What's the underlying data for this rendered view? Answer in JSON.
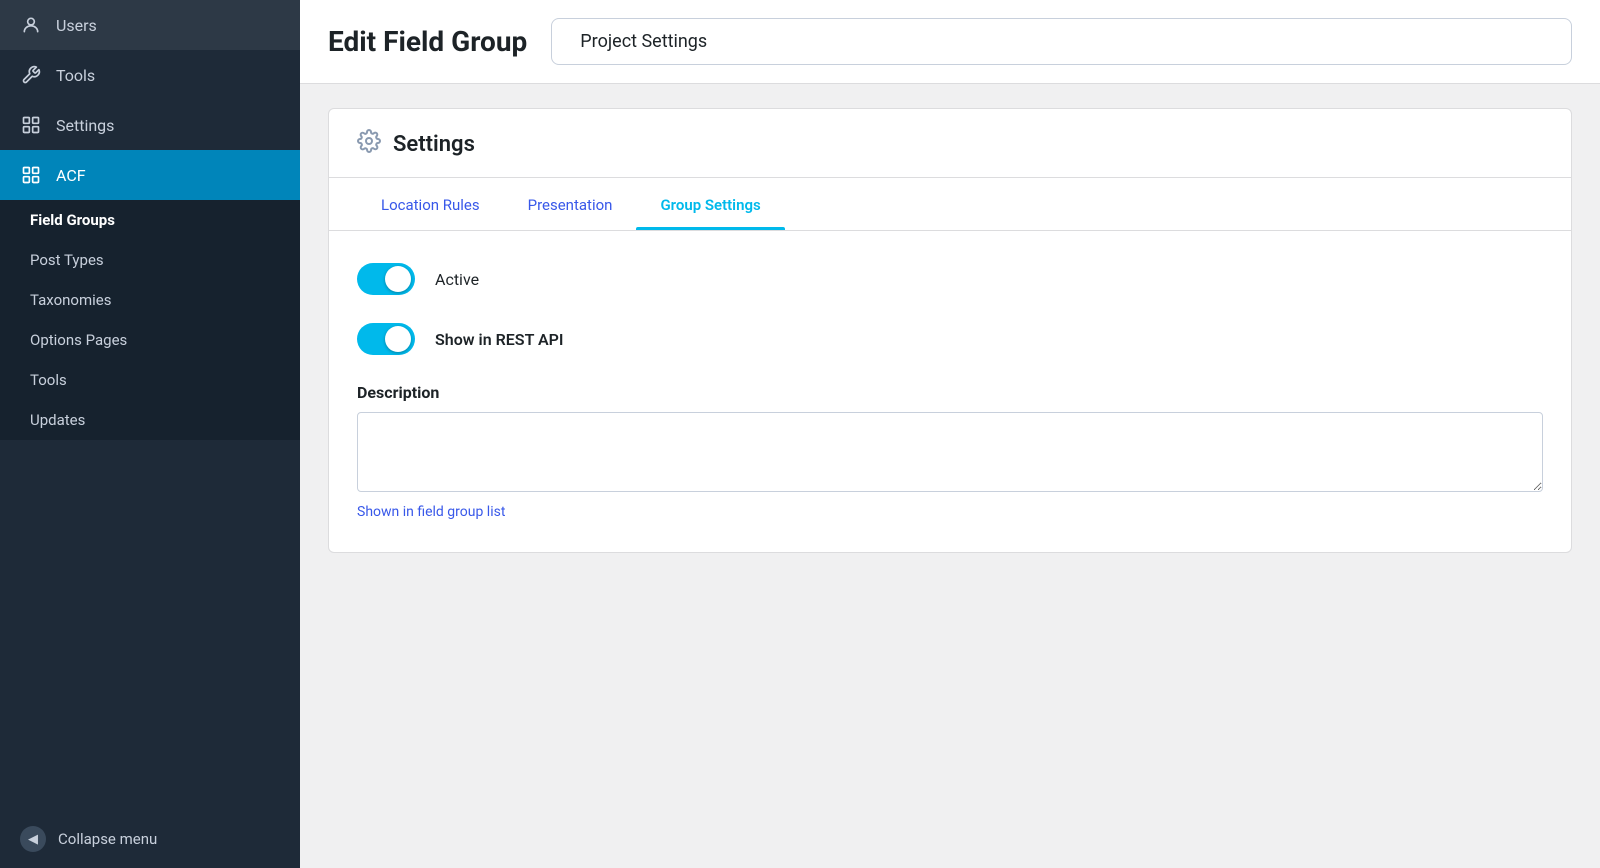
{
  "sidebar": {
    "items": [
      {
        "id": "users",
        "label": "Users",
        "icon": "👤"
      },
      {
        "id": "tools",
        "label": "Tools",
        "icon": "🔧"
      },
      {
        "id": "settings",
        "label": "Settings",
        "icon": "⊞"
      },
      {
        "id": "acf",
        "label": "ACF",
        "icon": "⊞",
        "active": true
      }
    ],
    "section_items": [
      {
        "id": "field-groups",
        "label": "Field Groups",
        "active": true
      },
      {
        "id": "post-types",
        "label": "Post Types"
      },
      {
        "id": "taxonomies",
        "label": "Taxonomies"
      },
      {
        "id": "options-pages",
        "label": "Options Pages"
      },
      {
        "id": "tools",
        "label": "Tools"
      },
      {
        "id": "updates",
        "label": "Updates"
      }
    ],
    "collapse_label": "Collapse menu"
  },
  "header": {
    "page_title": "Edit Field Group",
    "breadcrumb": "Project Settings"
  },
  "card": {
    "settings_label": "Settings",
    "tabs": [
      {
        "id": "location-rules",
        "label": "Location Rules",
        "active": false
      },
      {
        "id": "presentation",
        "label": "Presentation",
        "active": false
      },
      {
        "id": "group-settings",
        "label": "Group Settings",
        "active": true
      }
    ],
    "toggles": [
      {
        "id": "active",
        "label": "Active",
        "checked": true,
        "bold": false
      },
      {
        "id": "show-rest-api",
        "label": "Show in REST API",
        "checked": true,
        "bold": true
      }
    ],
    "description_label": "Description",
    "description_value": "",
    "description_hint": "Shown in field group list"
  }
}
